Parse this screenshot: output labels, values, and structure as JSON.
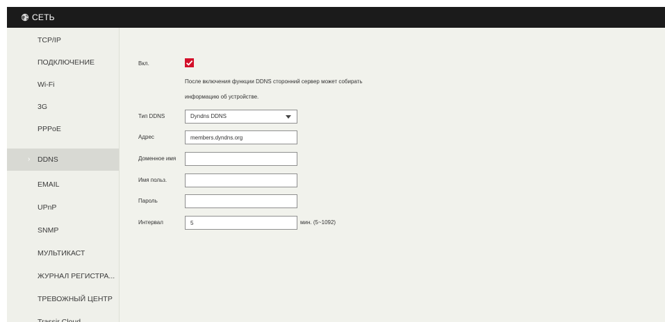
{
  "header": {
    "title": "СЕТЬ",
    "icon": "globe-icon"
  },
  "sidebar": {
    "items": [
      {
        "label": "TCP/IP",
        "active": false
      },
      {
        "label": "ПОДКЛЮЧЕНИЕ",
        "active": false
      },
      {
        "label": "Wi-Fi",
        "active": false
      },
      {
        "label": "3G",
        "active": false
      },
      {
        "label": "PPPoE",
        "active": false
      },
      {
        "label": "DDNS",
        "active": true
      },
      {
        "label": "EMAIL",
        "active": false
      },
      {
        "label": "UPnP",
        "active": false
      },
      {
        "label": "SNMP",
        "active": false
      },
      {
        "label": "МУЛЬТИКАСТ",
        "active": false
      },
      {
        "label": "ЖУРНАЛ РЕГИСТРА...",
        "active": false
      },
      {
        "label": "ТРЕВОЖНЫЙ ЦЕНТР",
        "active": false
      },
      {
        "label": "Trassir Cloud",
        "active": false
      }
    ],
    "active_marker": "›"
  },
  "form": {
    "enable_label": "Вкл.",
    "enable_checked": true,
    "note_line1": "После включения функции DDNS сторонний сервер может собирать",
    "note_line2": "информацию об устройстве.",
    "ddns_type_label": "Тип DDNS",
    "ddns_type_value": "Dyndns DDNS",
    "address_label": "Адрес",
    "address_value": "members.dyndns.org",
    "domain_label": "Доменное имя",
    "domain_value": "",
    "username_label": "Имя польз.",
    "username_value": "",
    "password_label": "Пароль",
    "password_value": "",
    "interval_label": "Интервал",
    "interval_value": "5",
    "interval_unit": "мин. (5~1092)"
  },
  "colors": {
    "titlebar": "#1b1b1b",
    "accent": "#d3102a",
    "background": "#f1f2ec",
    "active_item": "#d8d9d3"
  }
}
